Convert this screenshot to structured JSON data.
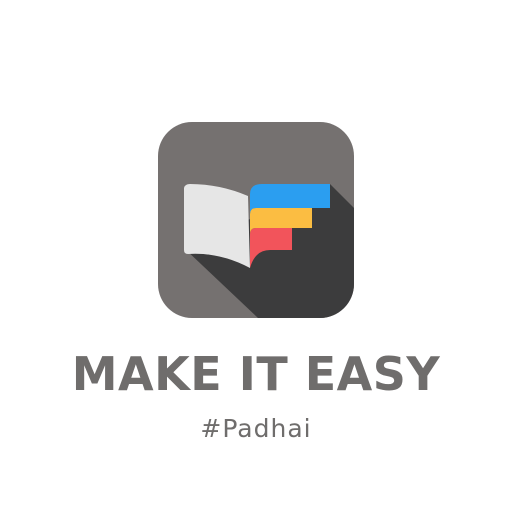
{
  "brand": {
    "title": "MAKE IT EASY",
    "tagline": "#Padhai"
  },
  "logo": {
    "icon_name": "open-book-steps-icon",
    "colors": {
      "background": "#757170",
      "shadow": "#3c3c3d",
      "page": "#e6e6e6",
      "step_blue": "#2b9ef0",
      "step_yellow": "#fbbd42",
      "step_red": "#f2545b",
      "text": "#6f6d6c"
    }
  }
}
